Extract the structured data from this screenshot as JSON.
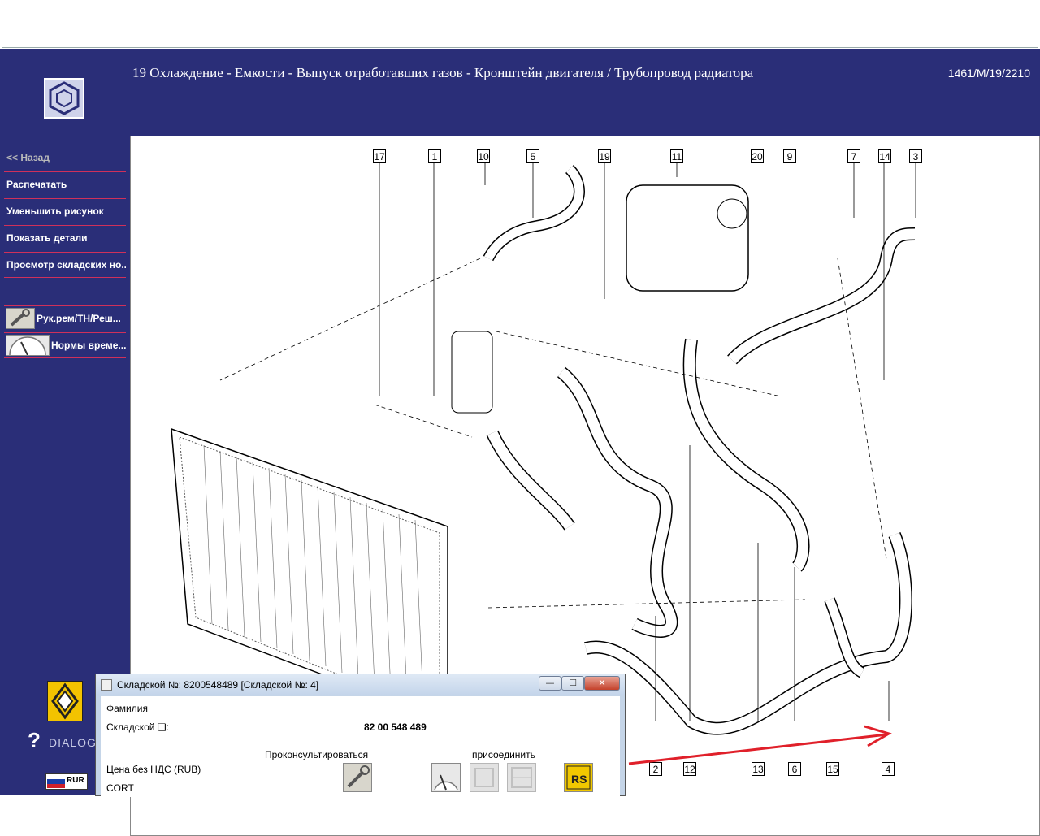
{
  "header": {
    "title": "19 Охлаждение - Емкости - Выпуск отработавших газов - Кронштейн двигателя / Трубопровод радиатора",
    "reference": "1461/M/19/2210"
  },
  "sidebar": {
    "items": [
      {
        "label": "<< Назад"
      },
      {
        "label": "Распечатать"
      },
      {
        "label": "Уменьшить рисунок"
      },
      {
        "label": "Показать детали"
      },
      {
        "label": "Просмотр складских но..."
      }
    ],
    "tools": [
      {
        "label": "Рук.рем/ТН/Реш...",
        "icon": "wrench-manual-icon"
      },
      {
        "label": "Нормы време...",
        "icon": "stopwatch-icon"
      }
    ],
    "help_label": "DIALOG",
    "currency": "RUR"
  },
  "diagram": {
    "callouts": [
      "17",
      "1",
      "10",
      "5",
      "19",
      "11",
      "20",
      "9",
      "7",
      "14",
      "3",
      "2",
      "12",
      "13",
      "6",
      "15",
      "4"
    ]
  },
  "popup": {
    "title": "Складской №: 8200548489 [Складской №: 4]",
    "family_label": "Фамилия",
    "part_label": "Складской ❏:",
    "part_value": "82 00 548 489",
    "consult_label": "Проконсультироваться",
    "attach_label": "присоединить",
    "price_label": "Цена без НДС (RUB)",
    "cort_label": "CORT",
    "minimize": "—",
    "maximize": "☐",
    "close": "✕"
  },
  "colors": {
    "sidebar_bg": "#2a2e78",
    "accent_line": "#d0305a",
    "arrow": "#e0202a"
  }
}
